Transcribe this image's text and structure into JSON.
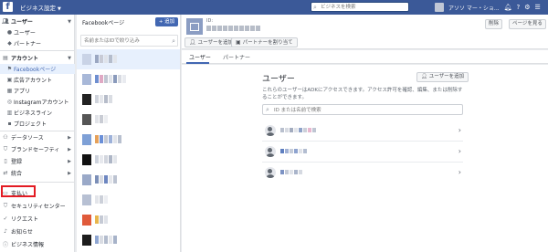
{
  "topbar": {
    "title": "ビジネス設定",
    "search_placeholder": "ビジネスを検索",
    "user_label": "アソソ マー・ショ..."
  },
  "sidebar": {
    "users_head": "ユーザー",
    "users_items": [
      "ユーザー",
      "パートナー"
    ],
    "accounts_head": "アカウント",
    "account_items": [
      "Facebookページ",
      "広告アカウント",
      "アプリ",
      "Instagramアカウント",
      "ビジネスライン",
      "プロジェクト"
    ],
    "sections": [
      "データソース",
      "ブランドセーフティ",
      "登録",
      "統合"
    ],
    "footer_items": [
      "支払い",
      "セキュリティセンター",
      "リクエスト",
      "お知らせ",
      "ビジネス情報"
    ]
  },
  "pages": {
    "title": "Facebookページ",
    "add_label": "+ 追加",
    "search_placeholder": "名前またはIDで絞り込み"
  },
  "page_header": {
    "id_label": "ID:",
    "remove_label": "削除",
    "view_label": "ページを見る",
    "add_user_label": "ユーザーを追加",
    "assign_partner_label": "パートナーを割り当て"
  },
  "tabs": [
    "ユーザー",
    "パートナー"
  ],
  "panel": {
    "title": "ユーザー",
    "add_label": "ユーザーを追加",
    "description": "これらのユーザーはADKにアクセスできます。アクセス許可を確認、編集、または削除することができます。",
    "search_placeholder": "ID または名前で検索"
  },
  "colors": {
    "brand": "#3b5998",
    "accent": "#4267b2",
    "highlight": "#e31b23"
  }
}
